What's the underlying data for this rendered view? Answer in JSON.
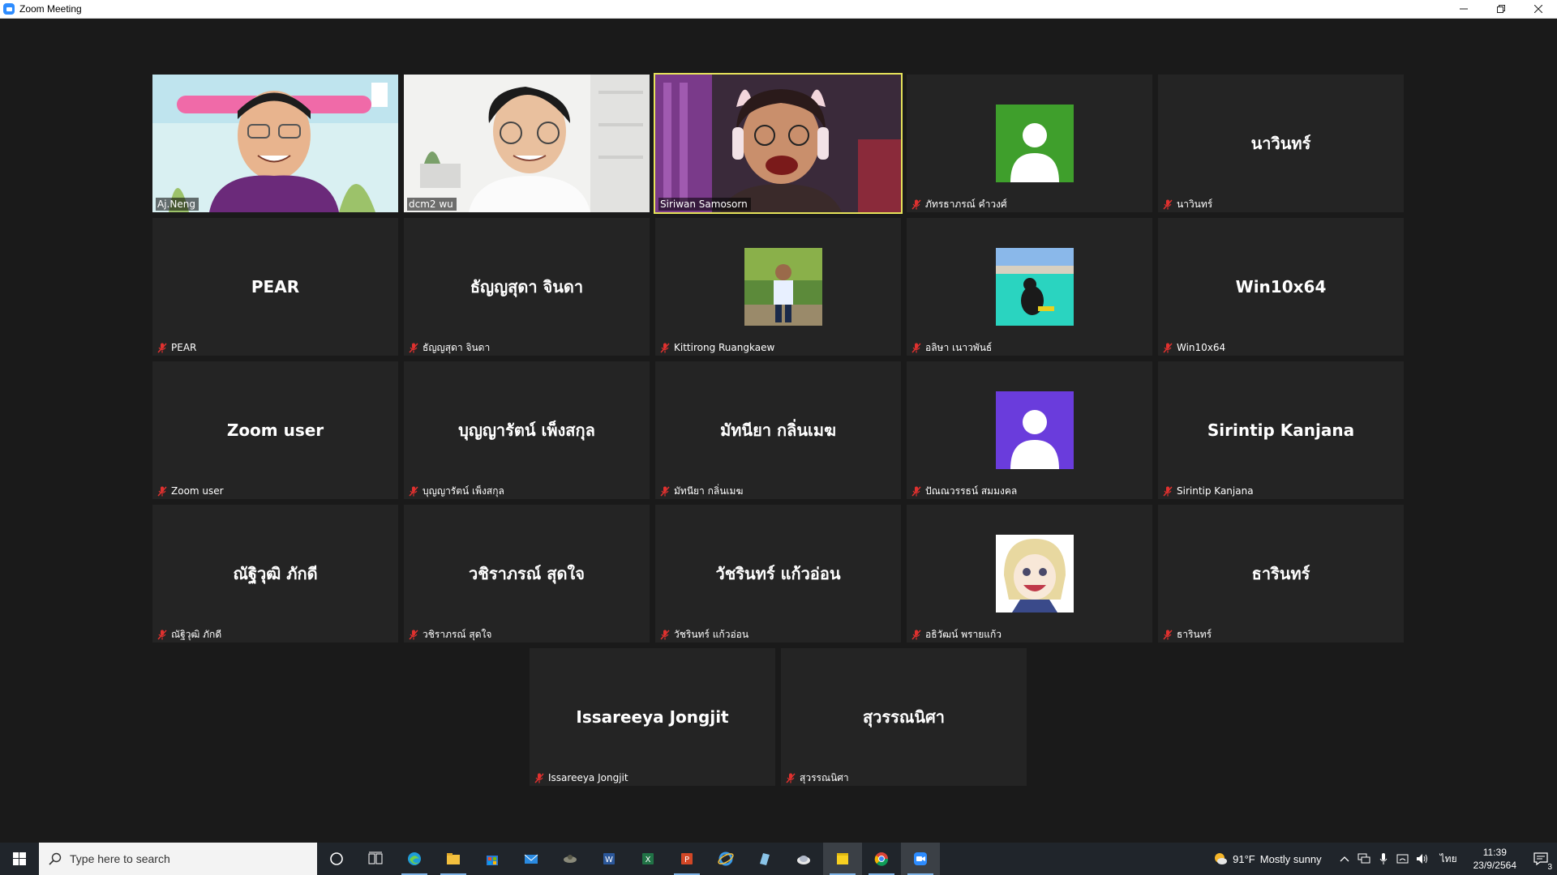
{
  "window": {
    "title": "Zoom Meeting",
    "icons": {
      "app": "zoom-icon",
      "minimize": "minimize-icon",
      "restore": "restore-icon",
      "close": "close-icon"
    }
  },
  "tiles": [
    {
      "label": "Aj.Neng",
      "big": "",
      "kind": "video1",
      "muted": false
    },
    {
      "label": "dcm2 wu",
      "big": "",
      "kind": "video2",
      "muted": false
    },
    {
      "label": "Siriwan Samosorn",
      "big": "",
      "kind": "video3",
      "muted": false,
      "active": true
    },
    {
      "label": "ภัทรธาภรณ์ คำวงศ์",
      "big": "",
      "kind": "avatar-green",
      "muted": true
    },
    {
      "label": "นาวินทร์",
      "big": "นาวินทร์",
      "kind": "name",
      "muted": true
    },
    {
      "label": "PEAR",
      "big": "PEAR",
      "kind": "name",
      "muted": true
    },
    {
      "label": "ธัญญสุดา จินดา",
      "big": "ธัญญสุดา จินดา",
      "kind": "name",
      "muted": true
    },
    {
      "label": "Kittirong Ruangkaew",
      "big": "",
      "kind": "photo-boy",
      "muted": true
    },
    {
      "label": "อลิษา เนาวพันธ์",
      "big": "",
      "kind": "photo-pool",
      "muted": true
    },
    {
      "label": "Win10x64",
      "big": "Win10x64",
      "kind": "name",
      "muted": true
    },
    {
      "label": "Zoom user",
      "big": "Zoom user",
      "kind": "name",
      "muted": true
    },
    {
      "label": "บุญญารัตน์ เพ็งสกุล",
      "big": "บุญญารัตน์ เพ็งสกุล",
      "kind": "name",
      "muted": true
    },
    {
      "label": "มัทนียา  กลิ่นเมฆ",
      "big": "มัทนียา  กลิ่นเมฆ",
      "kind": "name",
      "muted": true
    },
    {
      "label": "ปัณณวรรธน์ สมมงคล",
      "big": "",
      "kind": "avatar-purple",
      "muted": true
    },
    {
      "label": "Sirintip Kanjana",
      "big": "Sirintip Kanjana",
      "kind": "name",
      "muted": true
    },
    {
      "label": "ณัฐิวุฒิ ภักดี",
      "big": "ณัฐิวุฒิ ภักดี",
      "kind": "name",
      "muted": true
    },
    {
      "label": "วชิราภรณ์ สุดใจ",
      "big": "วชิราภรณ์ สุดใจ",
      "kind": "name",
      "muted": true
    },
    {
      "label": "วัชรินทร์ แก้วอ่อน",
      "big": "วัชรินทร์ แก้วอ่อน",
      "kind": "name",
      "muted": true
    },
    {
      "label": "อธิวัฒน์ พรายแก้ว",
      "big": "",
      "kind": "photo-anime",
      "muted": true
    },
    {
      "label": "ธารินทร์",
      "big": "ธารินทร์",
      "kind": "name",
      "muted": true
    },
    {
      "label": "Issareeya Jongjit",
      "big": "Issareeya Jongjit",
      "kind": "name",
      "muted": true
    },
    {
      "label": "สุวรรณนิศา",
      "big": "สุวรรณนิศา",
      "kind": "name",
      "muted": true
    }
  ],
  "taskbar": {
    "search_placeholder": "Type here to search",
    "apps": [
      "cortana-icon",
      "task-view-icon",
      "edge-icon",
      "file-explorer-icon",
      "store-icon",
      "mail-icon",
      "game-icon",
      "word-icon",
      "excel-icon",
      "powerpoint-icon",
      "ie-icon",
      "notes-icon",
      "cloud-icon",
      "sticky-notes-icon",
      "chrome-icon",
      "zoom-icon"
    ],
    "weather_temp": "91°F",
    "weather_text": "Mostly sunny",
    "language": "ไทย",
    "time": "11:39",
    "date": "23/9/2564",
    "notification_count": "3",
    "colors": {
      "taskbar_bg": "#20252b",
      "active_border": "#e6e35a"
    }
  }
}
